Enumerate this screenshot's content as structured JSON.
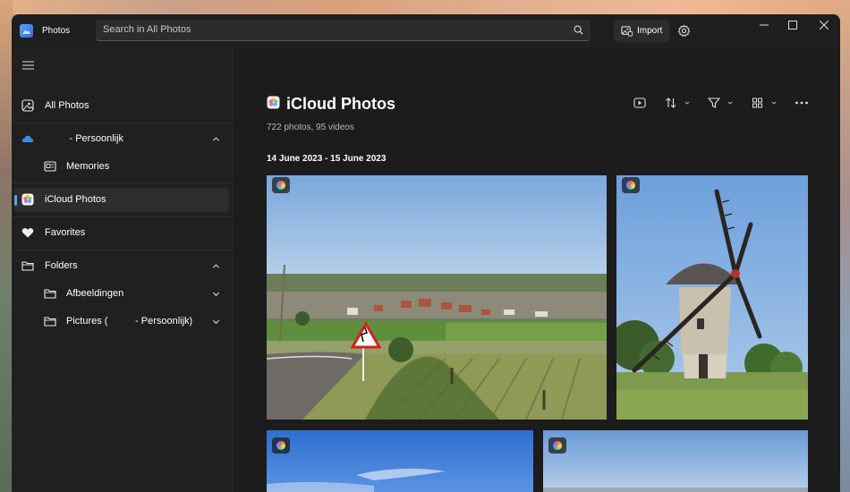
{
  "app": {
    "title": "Photos",
    "accent": "#4ea3ff"
  },
  "search": {
    "placeholder": "Search in All Photos"
  },
  "toolbar": {
    "import_label": "Import"
  },
  "sidebar": {
    "items": [
      {
        "label": "All Photos",
        "icon": "all-photos-icon"
      },
      {
        "label": "         - Persoonlijk",
        "icon": "onedrive-cloud-icon"
      },
      {
        "label": "Memories",
        "icon": "memories-icon"
      },
      {
        "label": "iCloud Photos",
        "icon": "icloud-photos-icon",
        "active": true
      },
      {
        "label": "Favorites",
        "icon": "heart-icon"
      },
      {
        "label": "Folders",
        "icon": "folder-icon"
      },
      {
        "label": "Afbeeldingen",
        "icon": "folder-icon"
      },
      {
        "label": "Pictures (          - Persoonlijk)",
        "icon": "folder-icon"
      }
    ]
  },
  "main": {
    "title": "iCloud Photos",
    "subtitle": "722 photos, 95 videos",
    "date_range": "14 June 2023 - 15 June 2023",
    "tools": [
      "slideshow-icon",
      "sort-icon",
      "filter-icon",
      "view-icon",
      "more-icon"
    ],
    "photos": [
      {
        "subject": "country road with curve warning sign and village"
      },
      {
        "subject": "stone windmill on grass"
      },
      {
        "subject": "blue sky with clouds"
      },
      {
        "subject": "blue sky over horizon"
      }
    ]
  }
}
